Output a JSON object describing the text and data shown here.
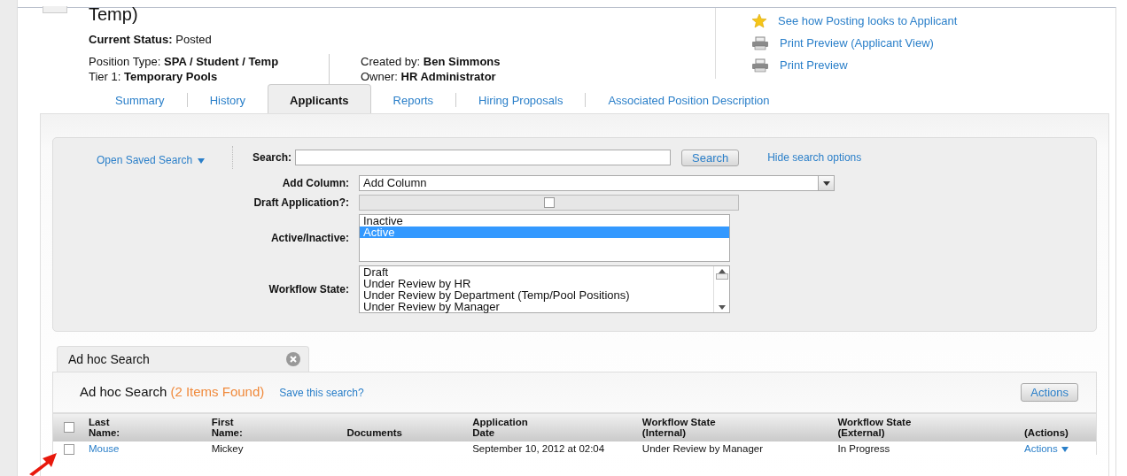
{
  "header": {
    "title": "Temp)",
    "status": "**Current Status:** Posted",
    "details_left": [
      "Position Type: **SPA / Student / Temp**",
      "Tier 1: **Temporary Pools**"
    ],
    "details_right": [
      "Created by: **Ben Simmons**",
      "Owner: **HR Administrator**"
    ],
    "links": [
      {
        "kind": "star",
        "text": "See how Posting looks to Applicant"
      },
      {
        "kind": "printer",
        "text": "Print Preview (Applicant View)"
      },
      {
        "kind": "printer",
        "text": "Print Preview"
      }
    ]
  },
  "tabs": [
    {
      "label": "Summary",
      "selected": false
    },
    {
      "label": "History",
      "selected": false
    },
    {
      "label": "Applicants",
      "selected": true
    },
    {
      "label": "Reports",
      "selected": false
    },
    {
      "label": "Hiring Proposals",
      "selected": false
    },
    {
      "label": "Associated Position Description",
      "selected": false
    }
  ],
  "search": {
    "saved_search": "Open Saved Search",
    "search_label": "Search:",
    "button": "Search",
    "hide_link": "Hide search options",
    "fields": [
      {
        "kind": "select",
        "label": "Add Column:",
        "value": "Add Column"
      },
      {
        "kind": "checkbox",
        "label": "Draft Application?:",
        "checked": false
      },
      {
        "kind": "listbox",
        "label": "Active/Inactive:",
        "options": [
          {
            "text": "Inactive",
            "selected": false
          },
          {
            "text": "Active",
            "selected": true
          }
        ]
      },
      {
        "kind": "listbox",
        "label": "Workflow State:",
        "options": [
          {
            "text": "Draft",
            "selected": false
          },
          {
            "text": "Under Review by HR",
            "selected": false
          },
          {
            "text": "Under Review by Department (Temp/Pool Positions)",
            "selected": false
          },
          {
            "text": "Under Review by Manager",
            "selected": false
          }
        ]
      }
    ]
  },
  "results": {
    "tab_label": "Ad hoc Search",
    "title": "Ad hoc Search",
    "count": "(2 Items Found)",
    "save_link": "Save this search?",
    "actions_button": "Actions",
    "select_all_checked": false,
    "columns": [
      "Last\nName:",
      "First\nName:",
      "Documents",
      "Application\nDate",
      "Workflow State\n(Internal)",
      "Workflow State\n(External)",
      "(Actions)"
    ],
    "rows": [
      {
        "checked": false,
        "last_name": "Mouse",
        "first_name": "Mickey",
        "application_date": "September 10, 2012 at 02:04",
        "workflow_internal": "Under Review by Manager",
        "workflow_external": "In Progress",
        "actions": "Actions"
      }
    ]
  }
}
